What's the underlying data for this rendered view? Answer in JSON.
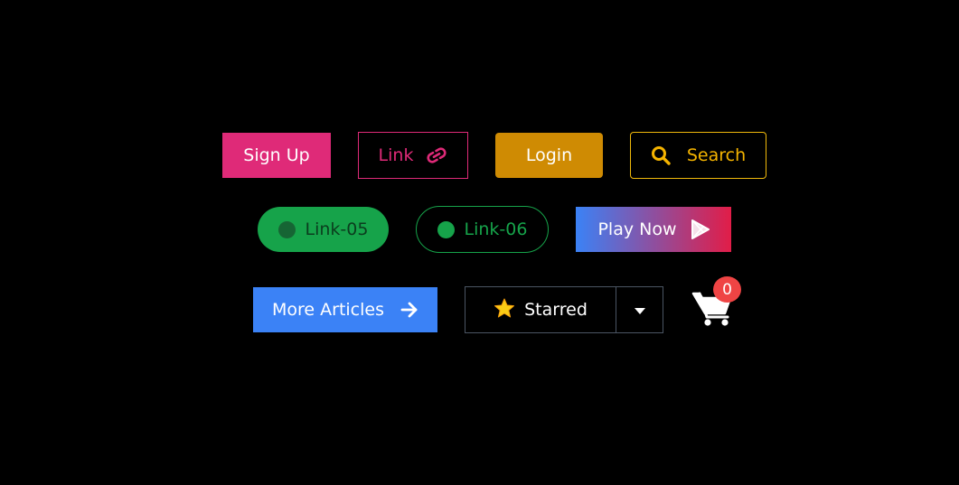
{
  "buttons": {
    "signup": {
      "label": "Sign Up"
    },
    "link": {
      "label": "Link",
      "icon": "link-icon"
    },
    "login": {
      "label": "Login"
    },
    "search": {
      "label": "Search",
      "icon": "search-icon"
    },
    "link05": {
      "label": "Link-05"
    },
    "link06": {
      "label": "Link-06"
    },
    "playnow": {
      "label": "Play Now",
      "icon": "play-store-icon"
    },
    "more_articles": {
      "label": "More Articles",
      "icon": "arrow-right-icon"
    },
    "starred": {
      "label": "Starred",
      "icon": "star-icon",
      "dropdown_icon": "caret-down-icon"
    },
    "cart": {
      "icon": "shopping-cart-icon",
      "count": "0"
    }
  },
  "colors": {
    "background": "#000000",
    "pink": "#df2a78",
    "amber": "#cf8b03",
    "yellow": "#f5b400",
    "green": "#16a34a",
    "blue": "#3b82f6",
    "red": "#ef4444"
  }
}
